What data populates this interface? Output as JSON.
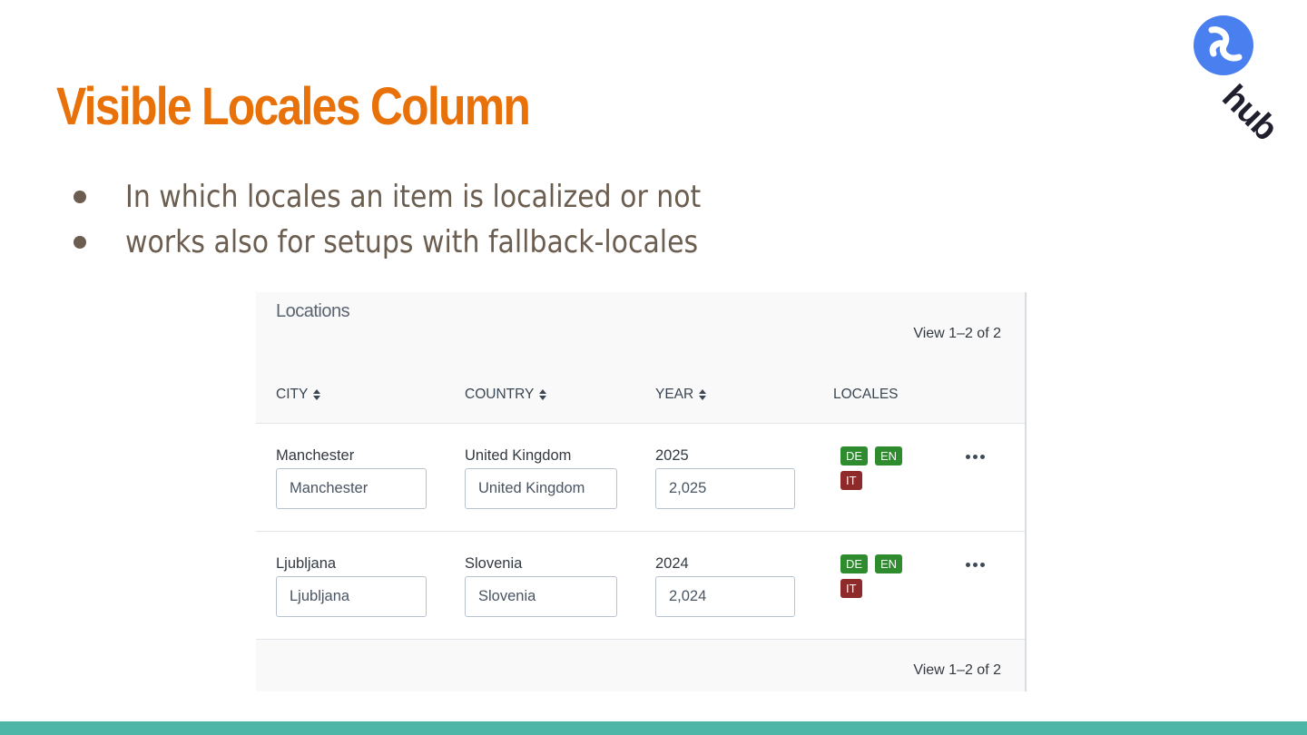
{
  "slide": {
    "title": "Visible Locales Column",
    "bullets": [
      "In which locales an item is localized or not",
      "works also for setups with fallback-locales"
    ],
    "logo_text": "hub"
  },
  "panel": {
    "title": "Locations",
    "view_count_top": "View 1–2 of 2",
    "view_count_bottom": "View 1–2 of 2",
    "columns": {
      "city": "CITY",
      "country": "COUNTRY",
      "year": "YEAR",
      "locales": "LOCALES"
    },
    "rows": [
      {
        "city_label": "Manchester",
        "city_value": "Manchester",
        "country_label": "United Kingdom",
        "country_value": "United Kingdom",
        "year_label": "2025",
        "year_value": "2,025",
        "locales": [
          {
            "code": "DE",
            "status": "localized"
          },
          {
            "code": "EN",
            "status": "localized"
          },
          {
            "code": "IT",
            "status": "not-localized"
          }
        ]
      },
      {
        "city_label": "Ljubljana",
        "city_value": "Ljubljana",
        "country_label": "Slovenia",
        "country_value": "Slovenia",
        "year_label": "2024",
        "year_value": "2,024",
        "locales": [
          {
            "code": "DE",
            "status": "localized"
          },
          {
            "code": "EN",
            "status": "localized"
          },
          {
            "code": "IT",
            "status": "not-localized"
          }
        ]
      }
    ]
  },
  "colors": {
    "title": "#e8710a",
    "bullet_text": "#6b5d4f",
    "logo_circle": "#4a7ff0",
    "bottom_bar": "#4db6a6",
    "badge_localized": "#2e8b2e",
    "badge_not_localized": "#8f2a2a"
  },
  "icons": {
    "sort": "sort-icon",
    "more": "more-icon",
    "logo": "hub-logo-icon"
  }
}
